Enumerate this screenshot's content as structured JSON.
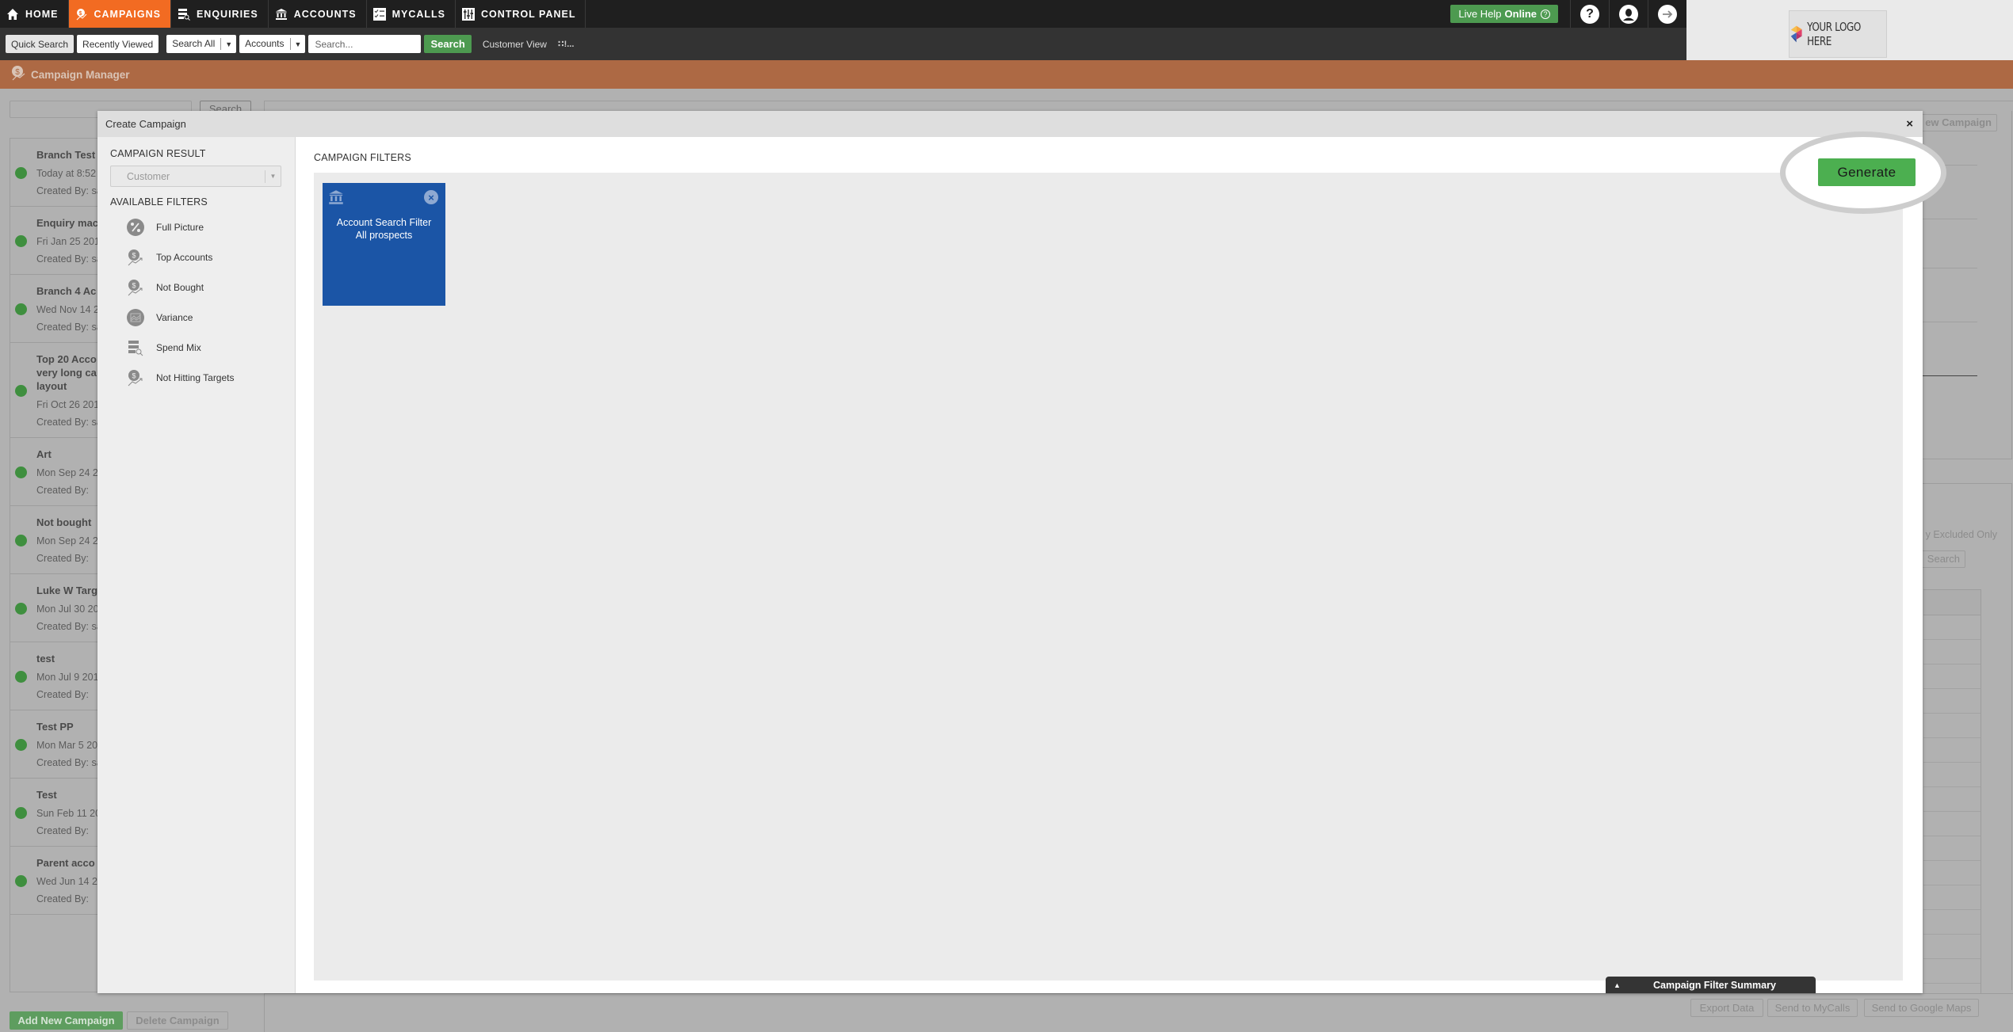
{
  "nav": {
    "items": [
      {
        "label": "HOME",
        "icon": "home-icon",
        "active": false
      },
      {
        "label": "CAMPAIGNS",
        "icon": "campaign-icon",
        "active": true
      },
      {
        "label": "ENQUIRIES",
        "icon": "enquiries-icon",
        "active": false
      },
      {
        "label": "ACCOUNTS",
        "icon": "bank-icon",
        "active": false
      },
      {
        "label": "MYCALLS",
        "icon": "checklist-icon",
        "active": false
      },
      {
        "label": "CONTROL PANEL",
        "icon": "control-panel-icon",
        "active": false
      }
    ],
    "live_help": {
      "prefix": "Live Help",
      "status": "Online",
      "q": "?"
    },
    "help_icon": "?",
    "colors": {
      "active": "#f26b22",
      "bar": "#1f1f1f",
      "live_help": "#4d9a50"
    }
  },
  "toolbar": {
    "quick_search": "Quick Search",
    "recently_viewed": "Recently Viewed",
    "search_scope": "Search All",
    "search_type": "Accounts",
    "search_placeholder": "Search...",
    "search_button": "Search",
    "customer_view": "Customer View",
    "more": "∷!..."
  },
  "logo": {
    "text": "YOUR LOGO HERE"
  },
  "page": {
    "title": "Campaign Manager",
    "header_color": "#ad6944",
    "bg_search_button": "Search",
    "bg_new_campaign": "ew Campaign",
    "bg_excluded": "y Excluded Only",
    "bg_search2": "Search"
  },
  "campaigns": [
    {
      "name": "Branch Test",
      "date": "Today at 8:52",
      "by": "Created By: sa"
    },
    {
      "name": "Enquiry mac",
      "date": "Fri Jan 25 201",
      "by": "Created By: sa"
    },
    {
      "name": "Branch 4 Ac",
      "date": "Wed Nov 14 2",
      "by": "Created By: sa"
    },
    {
      "name": "Top 20 Acco very long ca layout",
      "date": "Fri Oct 26 201",
      "by": "Created By: sa"
    },
    {
      "name": "Art",
      "date": "Mon Sep 24 2",
      "by": "Created By:"
    },
    {
      "name": "Not bought",
      "date": "Mon Sep 24 2",
      "by": "Created By:"
    },
    {
      "name": "Luke W Targ",
      "date": "Mon Jul 30 20",
      "by": "Created By: sa"
    },
    {
      "name": "test",
      "date": "Mon Jul 9 201",
      "by": "Created By:"
    },
    {
      "name": "Test PP",
      "date": "Mon Mar 5 20",
      "by": "Created By: sa"
    },
    {
      "name": "Test",
      "date": "Sun Feb 11 20",
      "by": "Created By:"
    },
    {
      "name": "Parent acco",
      "date": "Wed Jun 14 20",
      "by": "Created By:"
    }
  ],
  "footer": {
    "add_campaign": "Add New Campaign",
    "delete_campaign": "Delete Campaign",
    "export_data": "Export Data",
    "send_mycalls": "Send to MyCalls",
    "send_maps": "Send to Google Maps"
  },
  "modal": {
    "title": "Create Campaign",
    "close": "×",
    "campaign_result_label": "CAMPAIGN RESULT",
    "campaign_result_value": "Customer",
    "available_filters_label": "AVAILABLE FILTERS",
    "available_filters": [
      {
        "label": "Full Picture",
        "icon": "percent-icon"
      },
      {
        "label": "Top Accounts",
        "icon": "dollar-trend-icon"
      },
      {
        "label": "Not Bought",
        "icon": "dollar-trend-icon"
      },
      {
        "label": "Variance",
        "icon": "chart-icon"
      },
      {
        "label": "Spend Mix",
        "icon": "list-search-icon"
      },
      {
        "label": "Not Hitting Targets",
        "icon": "dollar-trend-icon"
      }
    ],
    "campaign_filters_label": "CAMPAIGN FILTERS",
    "applied_filters": [
      {
        "title": "Account Search Filter",
        "subtitle": "All prospects",
        "icon": "bank-icon",
        "color": "#1b55a6"
      }
    ],
    "generate": "Generate",
    "generate_color": "#4caf50",
    "summary_tab": "Campaign Filter Summary"
  }
}
